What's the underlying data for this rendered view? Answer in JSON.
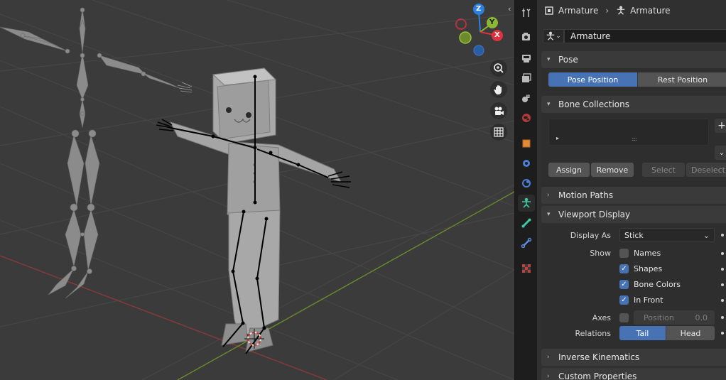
{
  "breadcrumb": {
    "object_name": "Armature",
    "data_name": "Armature"
  },
  "datablock": {
    "name": "Armature"
  },
  "sections": {
    "pose": {
      "title": "Pose",
      "pose_position": "Pose Position",
      "rest_position": "Rest Position",
      "active": "Pose Position"
    },
    "bone_collections": {
      "title": "Bone Collections",
      "add_symbol": "+",
      "grip_symbol": "::::",
      "assign": "Assign",
      "remove": "Remove",
      "select": "Select",
      "deselect": "Deselect"
    },
    "motion_paths": {
      "title": "Motion Paths"
    },
    "viewport_display": {
      "title": "Viewport Display",
      "display_as_label": "Display As",
      "display_as_value": "Stick",
      "show_label": "Show",
      "names_label": "Names",
      "names_checked": false,
      "shapes_label": "Shapes",
      "shapes_checked": true,
      "bone_colors_label": "Bone Colors",
      "bone_colors_checked": true,
      "in_front_label": "In Front",
      "in_front_checked": true,
      "axes_label": "Axes",
      "axes_checked": false,
      "position_label": "Position",
      "position_value": "0.0",
      "relations_label": "Relations",
      "relations_tail": "Tail",
      "relations_head": "Head",
      "relations_active": "Tail"
    },
    "inverse_kinematics": {
      "title": "Inverse Kinematics"
    },
    "custom_properties": {
      "title": "Custom Properties"
    }
  },
  "gizmo": {
    "z_label": "Z",
    "y_label": "Y",
    "x_label": "X"
  },
  "colors": {
    "accent": "#4772b3",
    "gizmo_x": "#e0313f",
    "gizmo_y": "#8bb733",
    "gizmo_z": "#2e80e0",
    "viewport_bg": "#3b3b3b",
    "panel_bg": "#303030",
    "armature_tab": "#3fc8a5"
  },
  "icons": {
    "tabs": [
      "tool-icon",
      "render-icon",
      "output-icon",
      "view-layer-icon",
      "scene-icon",
      "world-icon",
      "object-icon",
      "modifiers-icon",
      "physics-icon",
      "object-constraints-icon",
      "object-data-armature-icon",
      "bone-icon",
      "bone-constraint-icon",
      "texture-icon"
    ],
    "nav": [
      "zoom-icon",
      "pan-hand-icon",
      "camera-icon",
      "grid-icon"
    ]
  }
}
